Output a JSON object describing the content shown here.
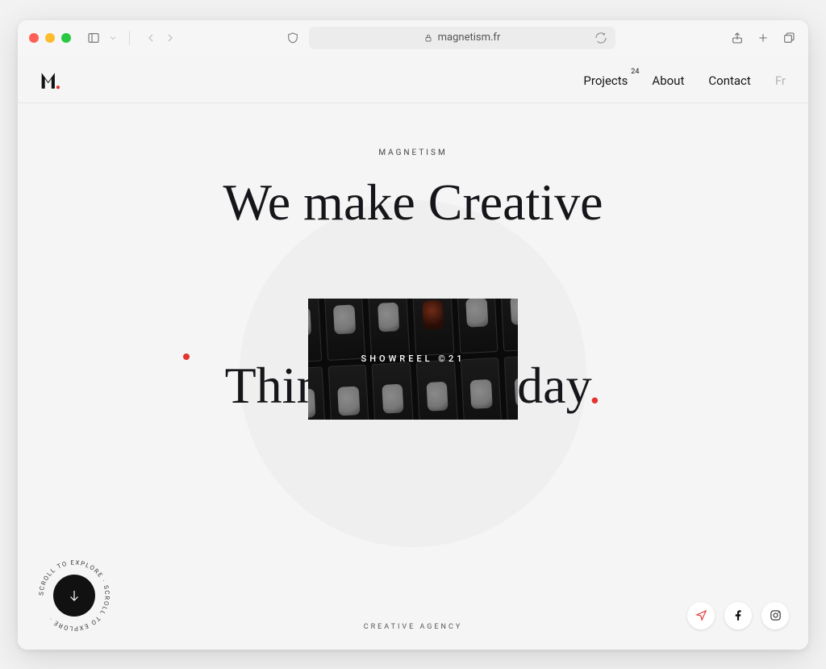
{
  "browser": {
    "url_display": "magnetism.fr"
  },
  "site": {
    "nav": {
      "projects": {
        "label": "Projects",
        "count": "24"
      },
      "about": "About",
      "contact": "Contact",
      "lang": "Fr"
    },
    "hero": {
      "eyebrow": "MAGNETISM",
      "line1": "We make Creative",
      "line2_part1": "Things, Everyday",
      "line2_dot": ".",
      "showreel_label": "SHOWREEL ©21",
      "sub_label": "CREATIVE AGENCY",
      "scroll_text": "SCROLL TO EXPLORE · SCROLL TO EXPLORE · "
    }
  }
}
